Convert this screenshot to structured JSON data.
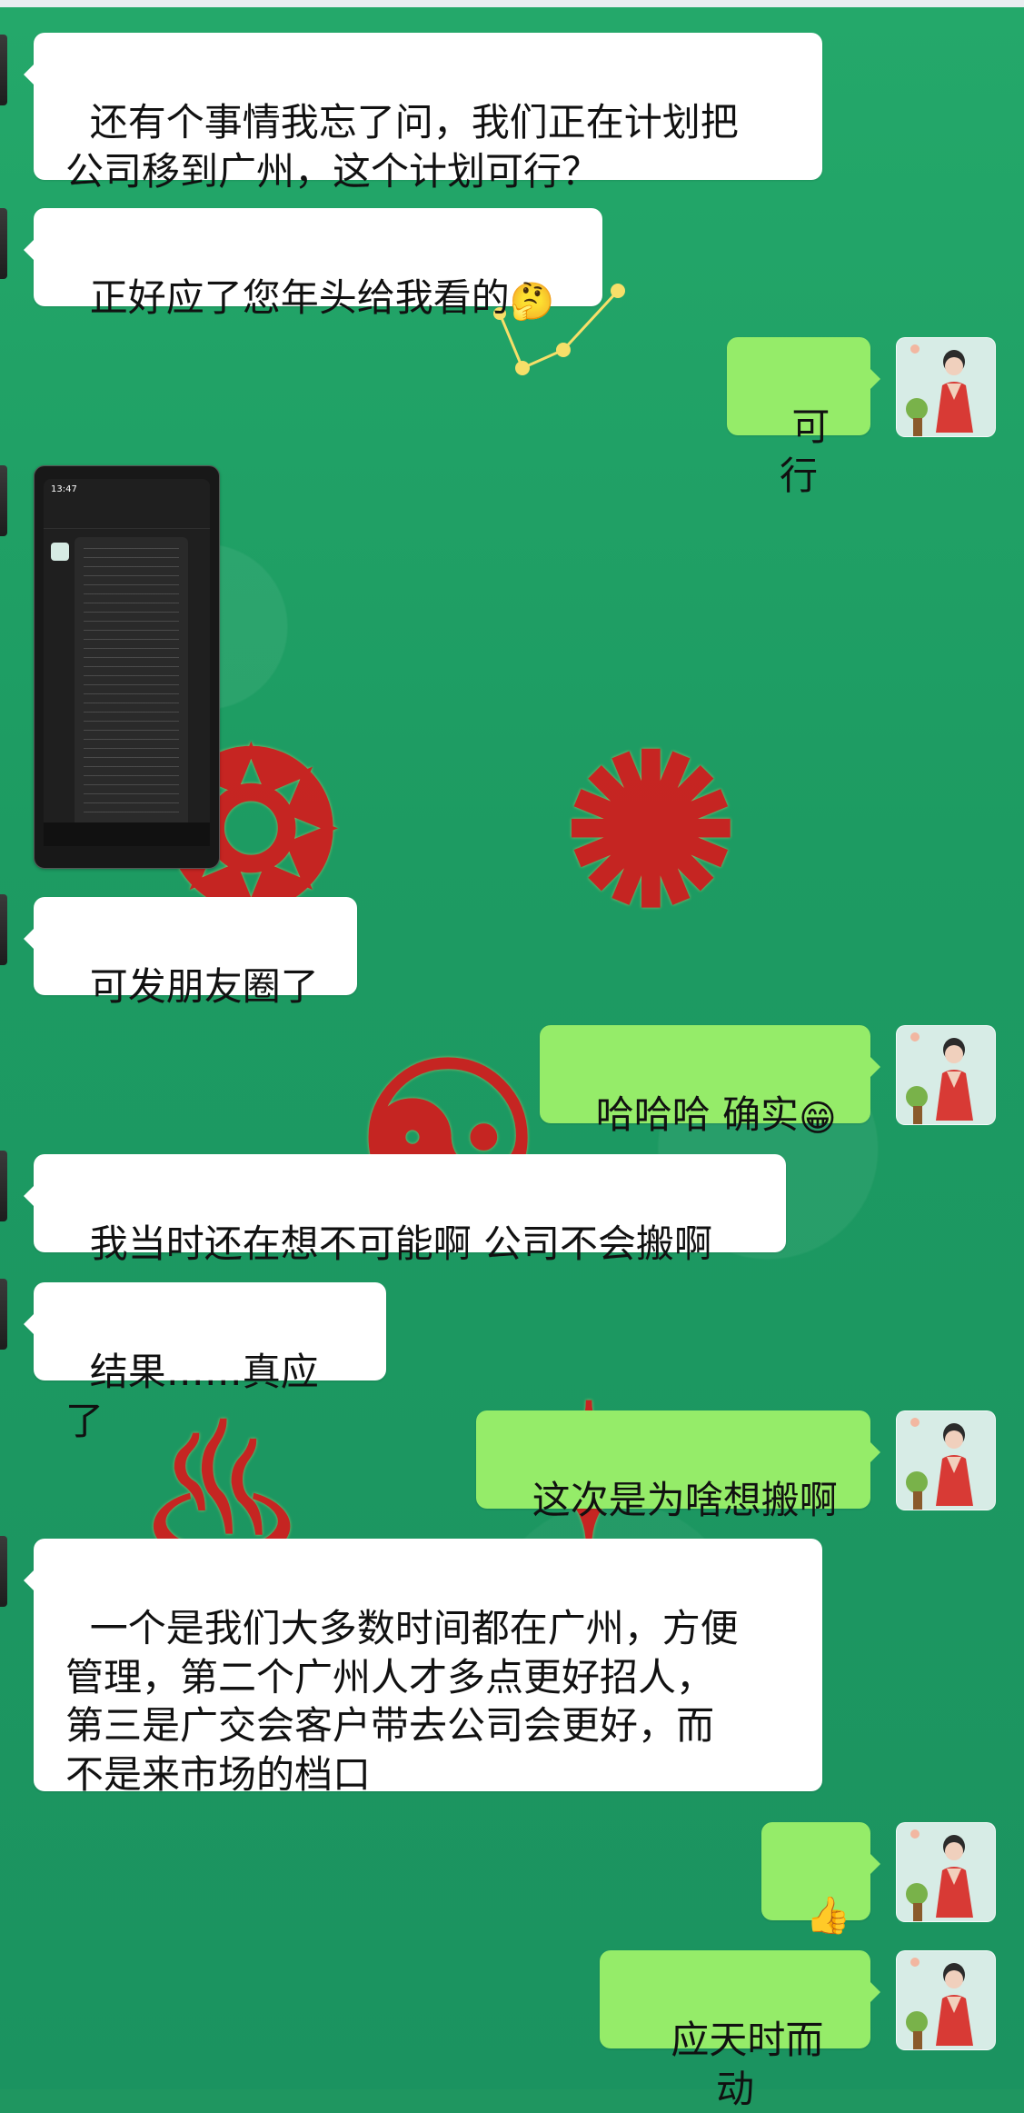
{
  "chat": {
    "messages": [
      {
        "side": "left",
        "text": "还有个事情我忘了问，我们正在计划把\n公司移到广州，这个计划可行？"
      },
      {
        "side": "left",
        "text": "正好应了您年头给我看的",
        "emoji": "🤔"
      },
      {
        "side": "right",
        "text": "可行"
      },
      {
        "side": "left",
        "type": "image",
        "thumb_time": "13:47"
      },
      {
        "side": "left",
        "text": "可发朋友圈了"
      },
      {
        "side": "right",
        "text": "哈哈哈 确实",
        "emoji": "😁"
      },
      {
        "side": "left",
        "text": "我当时还在想不可能啊 公司不会搬啊"
      },
      {
        "side": "left",
        "text": "结果……真应了"
      },
      {
        "side": "right",
        "text": "这次是为啥想搬啊"
      },
      {
        "side": "left",
        "text": "一个是我们大多数时间都在广州，方便\n管理，第二个广州人才多点更好招人，\n第三是广交会客户带去公司会更好，而\n不是来市场的档口"
      },
      {
        "side": "right",
        "text": "",
        "emoji": "👍"
      },
      {
        "side": "right",
        "text": "应天时而动"
      }
    ]
  }
}
